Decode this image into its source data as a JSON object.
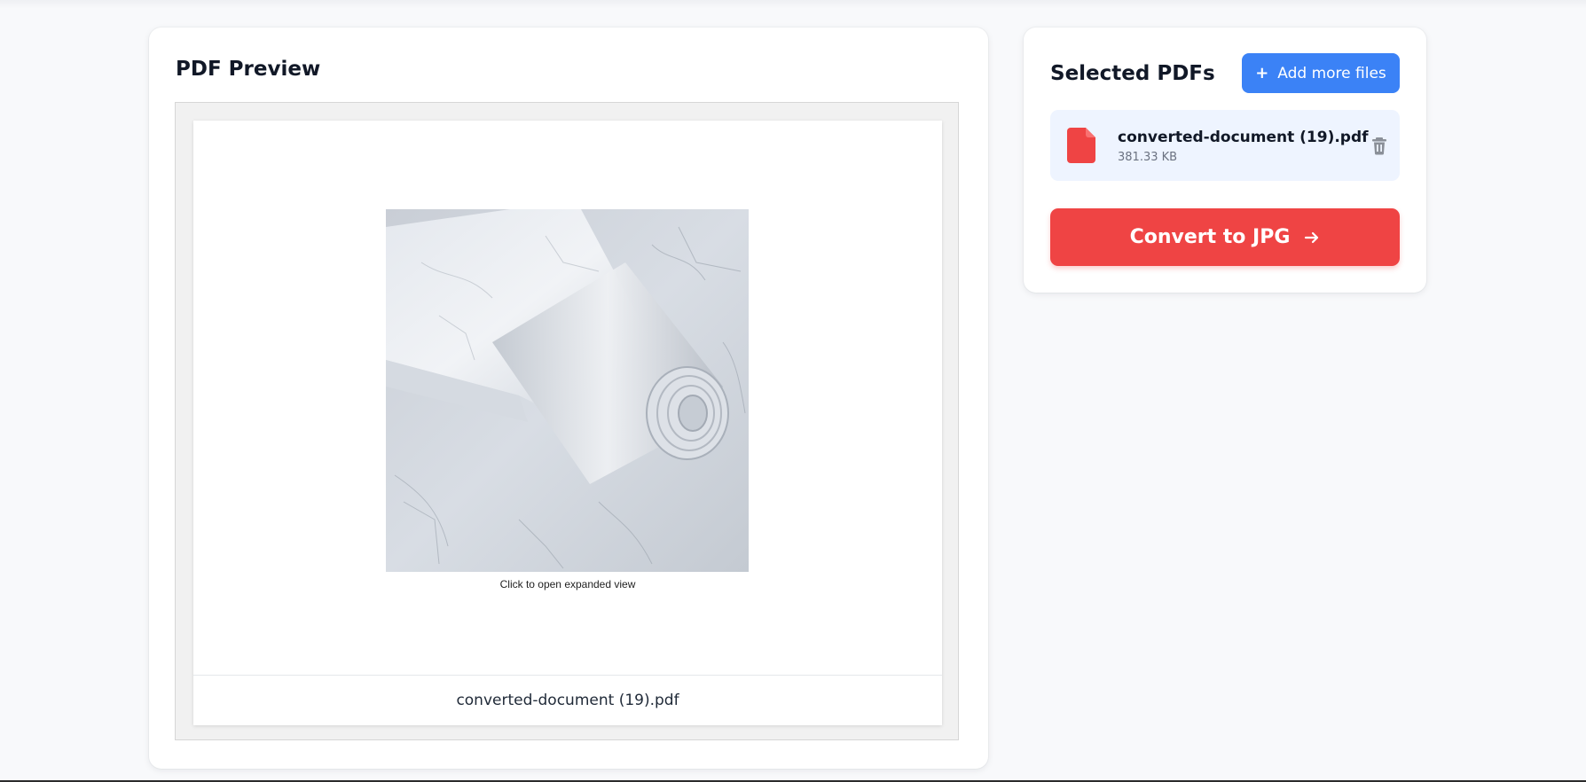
{
  "preview": {
    "title": "PDF Preview",
    "page_caption": "Click to open expanded view",
    "file_label": "converted-document (19).pdf",
    "image_icon": "marble-contact-paper-roll-image"
  },
  "selected": {
    "title": "Selected PDFs",
    "add_button_label": "Add more files",
    "add_button_icon": "plus-icon",
    "files": [
      {
        "name": "converted-document (19).pdf",
        "size": "381.33 KB",
        "icon": "pdf-file-icon",
        "action_icon": "trash-icon"
      }
    ]
  },
  "convert": {
    "label": "Convert to JPG",
    "icon": "arrow-right-icon"
  },
  "colors": {
    "primary_blue": "#3b82f6",
    "convert_red": "#ef4444",
    "file_item_bg": "#eef4ff",
    "page_bg": "#f8f9fb"
  }
}
